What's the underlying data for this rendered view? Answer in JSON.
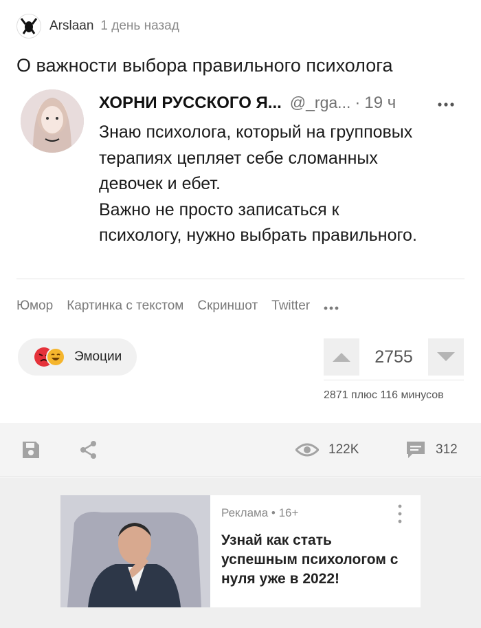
{
  "post": {
    "author": "Arslaan",
    "time": "1 день назад",
    "title": "О важности выбора правильного психолога"
  },
  "tweet": {
    "name": "ХОРНИ РУССКОГО Я...",
    "handle": "@_rga...",
    "separator": "·",
    "time": "19 ч",
    "more_icon": "more-dots-icon",
    "lines": [
      "Знаю психолога, который на групповых",
      "терапиях цепляет себе сломанных",
      "девочек и ебет.",
      "Важно не просто записаться к",
      "психологу, нужно выбрать правильного."
    ]
  },
  "tags": [
    "Юмор",
    "Картинка с текстом",
    "Скриншот",
    "Twitter"
  ],
  "emotions": {
    "label": "Эмоции",
    "icons": [
      "angry-face-icon",
      "laughing-face-icon"
    ]
  },
  "rating": {
    "value": "2755",
    "breakdown": "2871 плюс 116 минусов"
  },
  "actions": {
    "views": "122K",
    "comments": "312"
  },
  "ad": {
    "meta": "Реклама • 16+",
    "title": "Узнай как стать успешным психологом с нуля уже в 2022!"
  },
  "colors": {
    "accent_gray": "#9e9e9e",
    "ad_background": "#efefef"
  }
}
